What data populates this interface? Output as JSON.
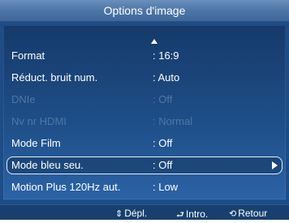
{
  "title": "Options d'image",
  "menu": {
    "items": [
      {
        "label": "Format",
        "value": ": 16:9",
        "state": "normal"
      },
      {
        "label": "Réduct. bruit num.",
        "value": ": Auto",
        "state": "normal"
      },
      {
        "label": "DNIe",
        "value": ": Off",
        "state": "disabled"
      },
      {
        "label": "Nv nr HDMI",
        "value": ": Normal",
        "state": "disabled"
      },
      {
        "label": "Mode Film",
        "value": ": Off",
        "state": "normal"
      },
      {
        "label": "Mode bleu seu.",
        "value": ": Off",
        "state": "selected"
      },
      {
        "label": "Motion Plus 120Hz aut.",
        "value": ": Low",
        "state": "normal"
      }
    ]
  },
  "footer": {
    "move": {
      "icon": "up-down-arrows-icon",
      "glyph": "⇕",
      "label": "Dépl."
    },
    "enter": {
      "icon": "enter-icon",
      "glyph": "⮐",
      "label": "Intro."
    },
    "back": {
      "icon": "return-icon",
      "glyph": "⟲",
      "label": "Retour"
    }
  },
  "colors": {
    "panel": "#1d4d86",
    "title_bar": "#4d76a8",
    "disabled_text": "#4f76a6",
    "text": "#ffffff"
  }
}
